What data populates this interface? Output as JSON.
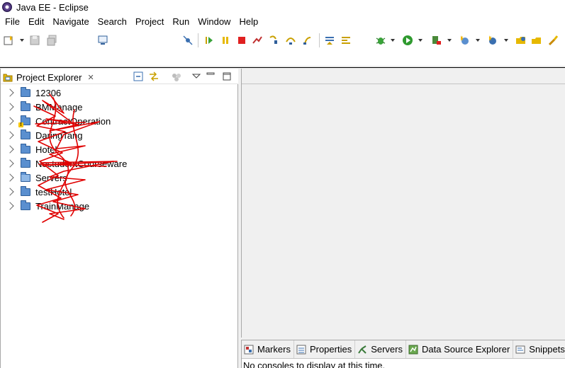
{
  "window": {
    "title": "Java EE - Eclipse",
    "icon": "eclipse-icon"
  },
  "menu": [
    "File",
    "Edit",
    "Navigate",
    "Search",
    "Project",
    "Run",
    "Window",
    "Help"
  ],
  "toolbar": {
    "icons": [
      "new-icon",
      "save-icon",
      "save-all-icon",
      "console-icon",
      "skip-breakpoints-icon",
      "resume-icon",
      "suspend-icon",
      "terminate-icon",
      "disconnect-icon",
      "step-into-icon",
      "step-over-icon",
      "step-return-icon",
      "drop-to-frame-icon",
      "use-step-filters-icon",
      "debug-icon",
      "run-icon",
      "run-server-icon",
      "new-server-icon",
      "new-java-class-icon",
      "open-type-icon",
      "open-task-icon",
      "search-icon"
    ]
  },
  "explorer": {
    "title": "Project Explorer",
    "close_glyph": "✕",
    "tools": [
      "collapse-all-icon",
      "link-with-editor-icon",
      "focus-icon",
      "view-menu-icon",
      "minimize-icon",
      "maximize-icon"
    ],
    "projects": [
      {
        "label": "12306",
        "icon": "folder-icon"
      },
      {
        "label": "BMManage",
        "icon": "folder-icon"
      },
      {
        "label": "ContractOperation",
        "icon": "warning-project-icon"
      },
      {
        "label": "DaringTang",
        "icon": "folder-icon"
      },
      {
        "label": "Hotel",
        "icon": "folder-icon"
      },
      {
        "label": "NostudentCourseware",
        "icon": "folder-icon"
      },
      {
        "label": "Servers",
        "icon": "open-folder-icon"
      },
      {
        "label": "testHotel",
        "icon": "folder-icon"
      },
      {
        "label": "TrainManage",
        "icon": "folder-icon"
      }
    ]
  },
  "bottom_panel": {
    "tabs": [
      {
        "label": "Markers",
        "icon": "markers-icon"
      },
      {
        "label": "Properties",
        "icon": "properties-icon"
      },
      {
        "label": "Servers",
        "icon": "servers-icon"
      },
      {
        "label": "Data Source Explorer",
        "icon": "data-source-icon"
      },
      {
        "label": "Snippets",
        "icon": "snippets-icon"
      }
    ],
    "console_message": "No consoles to display at this time."
  },
  "colors": {
    "scribble": "#e00000",
    "folder": "#5a8fcf",
    "selection_border": "#a8a8a8"
  }
}
